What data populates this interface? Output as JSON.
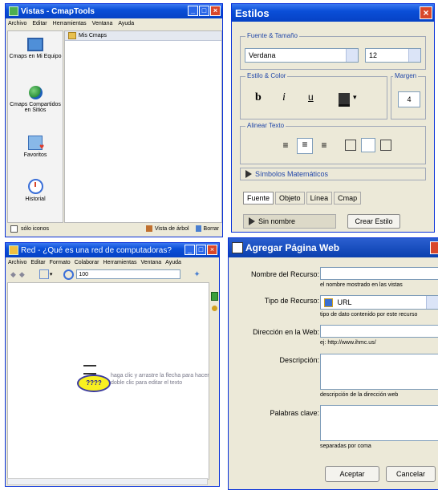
{
  "vistas": {
    "title": "Vistas - CmapTools",
    "menu": [
      "Archivo",
      "Editar",
      "Herramientas",
      "Ventana",
      "Ayuda"
    ],
    "sidebar": [
      {
        "label": "Cmaps en Mi Equipo",
        "icon": "computer-icon"
      },
      {
        "label": "Cmaps Compartidos en Sitios",
        "icon": "globe-icon"
      },
      {
        "label": "Favoritos",
        "icon": "favorites-icon"
      },
      {
        "label": "Historial",
        "icon": "history-icon"
      }
    ],
    "folder_header": "Mis Cmaps",
    "only_icons": "sólo iconos",
    "tree_view": "Vista de árbol",
    "delete": "Borrar"
  },
  "estilos": {
    "title": "Estilos",
    "font_size_legend": "Fuente & Tamaño",
    "font_name": "Verdana",
    "font_size": "12",
    "style_color_legend": "Estilo & Color",
    "bold": "b",
    "italic": "i",
    "underline": "u",
    "margin_legend": "Margen",
    "margin_value": "4",
    "align_legend": "Alinear Texto",
    "math_symbols": "Símbolos Matemáticos",
    "tabs": [
      "Fuente",
      "Objeto",
      "Línea",
      "Cmap"
    ],
    "style_name": "Sin nombre",
    "create_style": "Crear Estilo"
  },
  "red": {
    "title": "Red - ¿Qué es una red de computadoras?",
    "menu": [
      "Archivo",
      "Editar",
      "Formato",
      "Colaborar",
      "Herramientas",
      "Ventana",
      "Ayuda"
    ],
    "zoom": "100",
    "concept": "????",
    "hint_line1": "haga clic y arrastre la flecha para hacer",
    "hint_line2": "doble clic para editar el texto"
  },
  "agregar": {
    "title": "Agregar Página Web",
    "resource_name_label": "Nombre del Recurso:",
    "resource_name_hint": "el nombre mostrado en las vistas",
    "resource_type_label": "Tipo de Recurso:",
    "resource_type_value": "URL",
    "resource_type_hint": "tipo de dato contenido por este recurso",
    "web_address_label": "Dirección en la Web:",
    "web_address_hint": "ej: http://www.ihmc.us/",
    "description_label": "Descripción:",
    "description_hint": "descripción de la dirección web",
    "keywords_label": "Palabras clave:",
    "keywords_hint": "separadas por coma",
    "accept": "Aceptar",
    "cancel": "Cancelar"
  },
  "colors": {
    "titlebar": "#0a4fd8",
    "window_bg": "#ece9d8",
    "close": "#d9472a"
  }
}
